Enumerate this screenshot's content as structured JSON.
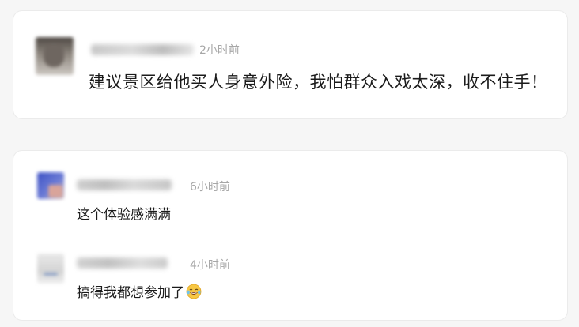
{
  "comments": [
    {
      "author": "",
      "time": "2小时前",
      "text": "建议景区给他买人身意外险，我怕群众入戏太深，收不住手！",
      "avatar_colors": [
        "#5b5550",
        "#a39c94",
        "#d7d2cc"
      ]
    },
    {
      "author": "",
      "time": "6小时前",
      "text": "这个体验感满满",
      "avatar_colors": [
        "#4a5fc8",
        "#7888d8",
        "#c9b9c2"
      ]
    },
    {
      "author": "",
      "time": "4小时前",
      "text": "搞得我都想参加了",
      "emoji": "laughing-tears-emoji",
      "avatar_colors": [
        "#e2e2e2",
        "#cfcfcf",
        "#f1f1f1"
      ]
    }
  ],
  "colors": {
    "background": "#f6f6f6",
    "card": "#ffffff",
    "text": "#1b1b1b",
    "timestamp": "#a7a7a7",
    "blurred_name": "#d4d4d4"
  }
}
